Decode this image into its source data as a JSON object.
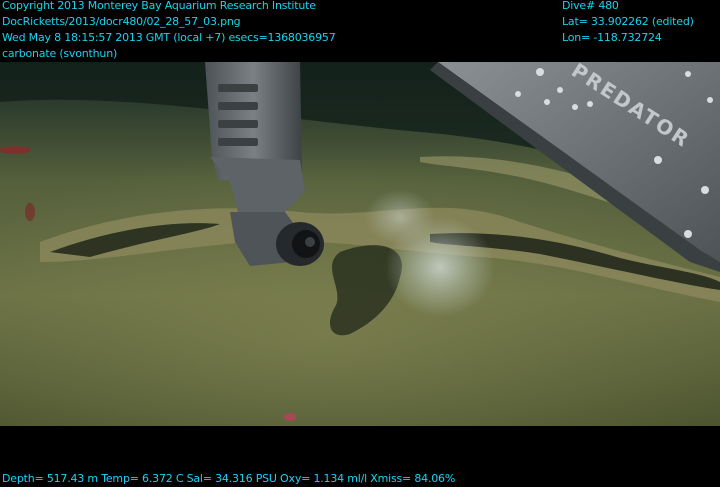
{
  "header_left": {
    "line1": "Copyright 2013 Monterey Bay Aquarium Research Institute",
    "line2": "DocRicketts/2013/docr480/02_28_57_03.png",
    "line3": "Wed May  8 18:15:57 2013 GMT (local +7)  esecs=1368036957",
    "line4": "carbonate (svonthun)"
  },
  "header_right": {
    "dive": "Dive# 480",
    "lat": "Lat= 33.902262 (edited)",
    "lon": "Lon= -118.732724"
  },
  "footer": {
    "telemetry": "Depth= 517.43 m  Temp= 6.372 C  Sal= 34.316 PSU  Oxy= 1.134 ml/l  Xmiss= 84.06%"
  },
  "vehicle": {
    "label": "PREDATOR"
  },
  "colors": {
    "overlay_text": "#19d3f0",
    "seafloor": "#5f6a3e",
    "water": "#1c2a22",
    "arm": "#6e7478"
  }
}
